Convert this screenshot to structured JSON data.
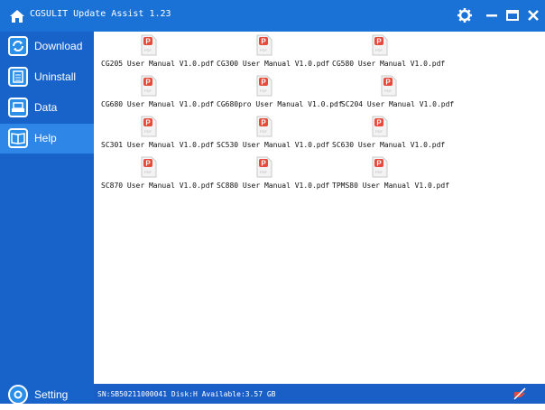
{
  "title": "CGSULIT Update Assist 1.23",
  "sidebar": {
    "items": [
      {
        "label": "Download"
      },
      {
        "label": "Uninstall"
      },
      {
        "label": "Data"
      },
      {
        "label": "Help"
      }
    ],
    "setting": "Setting"
  },
  "files": [
    "CG205 User Manual V1.0.pdf",
    "CG300 User Manual V1.0.pdf",
    "CG580 User Manual V1.0.pdf",
    "CG680 User Manual V1.0.pdf",
    "CG680pro User Manual V1.0.pdf",
    "SC204 User Manual V1.0.pdf",
    "SC301 User Manual V1.0.pdf",
    "SC530 User Manual V1.0.pdf",
    "SC630 User Manual V1.0.pdf",
    "SC870 User Manual V1.0.pdf",
    "SC880 User Manual V1.0.pdf",
    "TPMS80 User Manual V1.0.pdf"
  ],
  "status": {
    "text": "SN:SB50211000041  Disk:H  Available:3.57 GB"
  },
  "colors": {
    "titlebar": "#1a72d6",
    "sidebar": "#1763c9",
    "active": "#2e86e6",
    "pdf_red": "#e64a3b"
  }
}
